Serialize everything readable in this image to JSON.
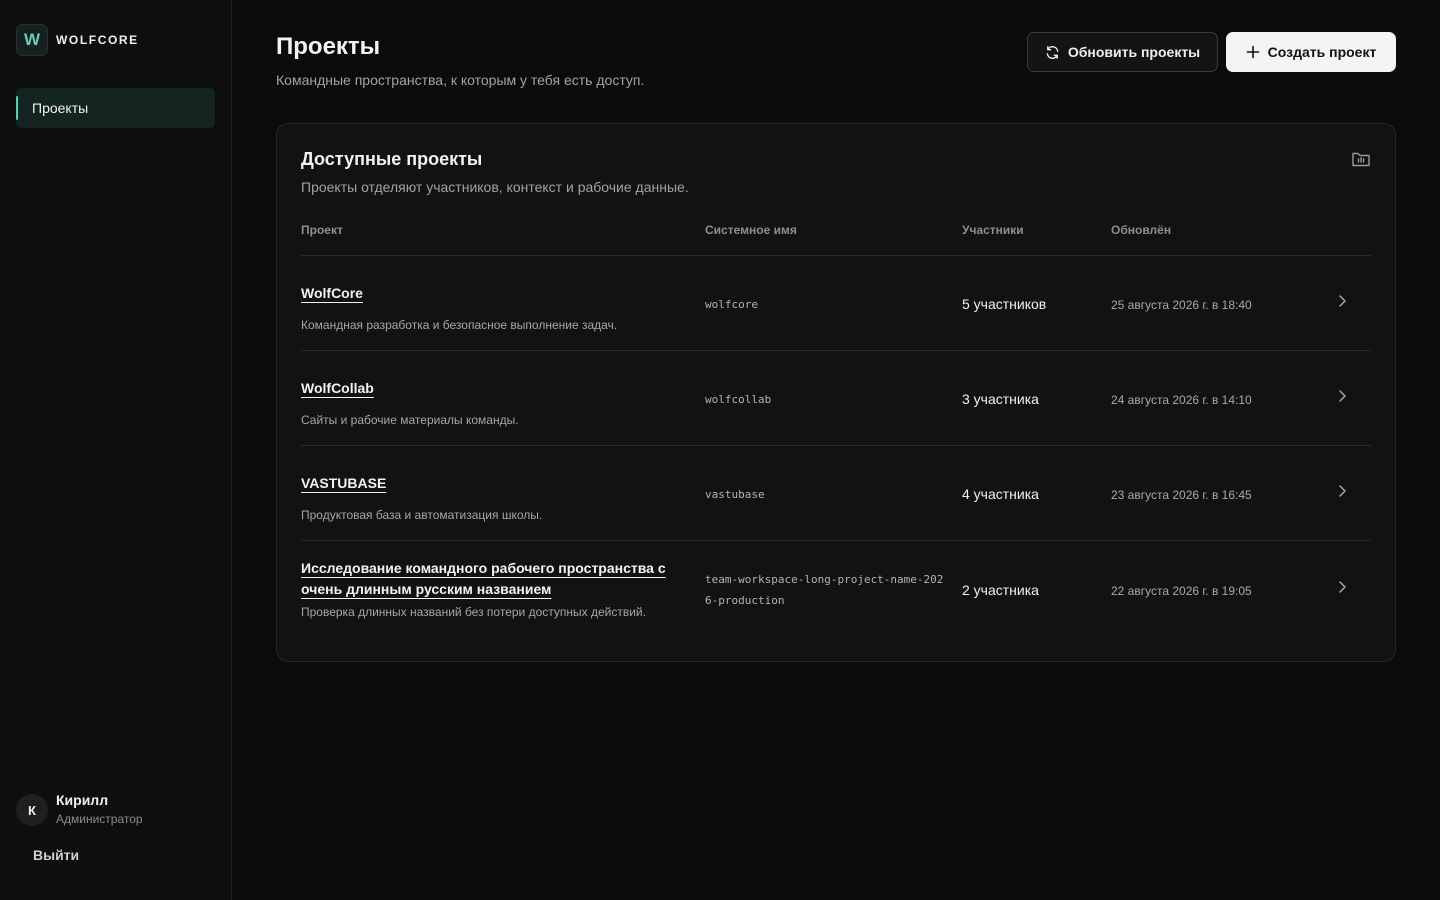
{
  "brand": {
    "logo_letter": "W",
    "name": "WOLFCORE",
    "accent": "#4fd0b3"
  },
  "sidebar": {
    "items": [
      {
        "label": "Проекты",
        "active": true
      }
    ]
  },
  "user": {
    "initial": "К",
    "name": "Кирилл",
    "role": "Администратор",
    "logout_label": "Выйти"
  },
  "header": {
    "title": "Проекты",
    "subtitle": "Командные пространства, к которым у тебя есть доступ.",
    "refresh_label": "Обновить проекты",
    "create_label": "Создать проект"
  },
  "card": {
    "title": "Доступные проекты",
    "subtitle": "Проекты отделяют участников, контекст и рабочие данные.",
    "columns": {
      "project": "Проект",
      "system_name": "Системное имя",
      "members": "Участники",
      "updated": "Обновлён"
    },
    "rows": [
      {
        "name": "WolfCore",
        "description": "Командная разработка и безопасное выполнение задач.",
        "system_name": "wolfcore",
        "members": "5 участников",
        "updated": "25 августа 2026 г. в 18:40"
      },
      {
        "name": "WolfCollab",
        "description": "Сайты и рабочие материалы команды.",
        "system_name": "wolfcollab",
        "members": "3 участника",
        "updated": "24 августа 2026 г. в 14:10"
      },
      {
        "name": "VASTUBASE",
        "description": "Продуктовая база и автоматизация школы.",
        "system_name": "vastubase",
        "members": "4 участника",
        "updated": "23 августа 2026 г. в 16:45"
      },
      {
        "name": "Исследование командного рабочего пространства с очень длинным русским названием",
        "description": "Проверка длинных названий без потери доступных действий.",
        "system_name": "team-workspace-long-project-name-2026-production",
        "members": "2 участника",
        "updated": "22 августа 2026 г. в 19:05"
      }
    ]
  }
}
